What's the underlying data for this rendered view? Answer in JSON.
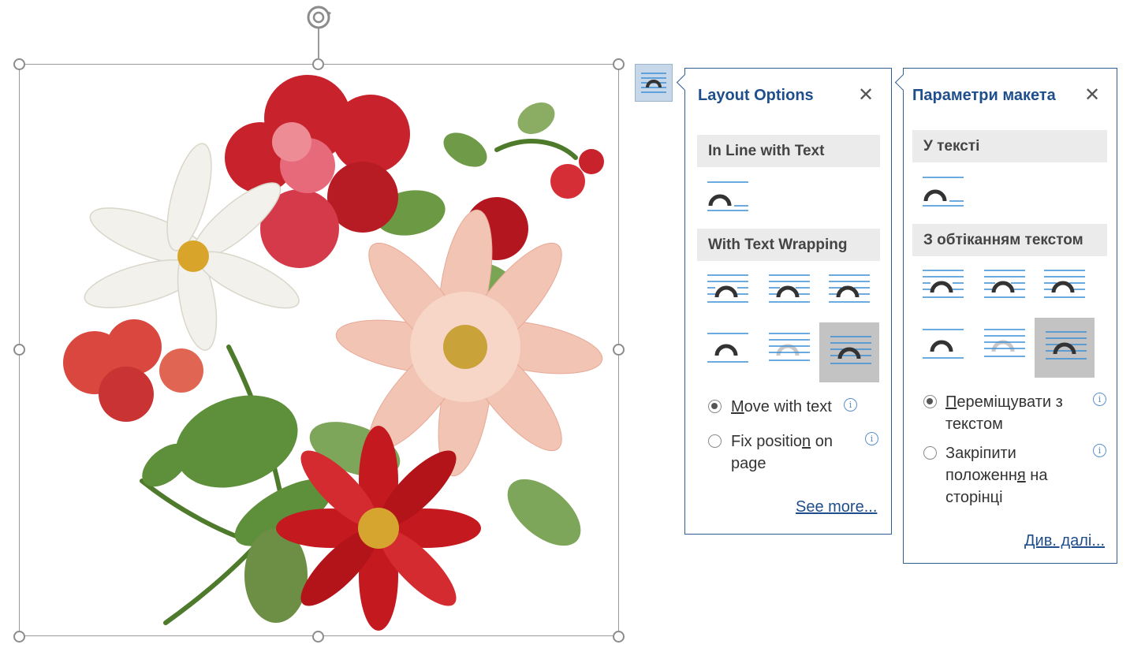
{
  "icons": {
    "rotate": "rotate-icon",
    "layout_button": "layout-options-icon",
    "close": "close-icon",
    "info": "info-icon"
  },
  "colors": {
    "panel_border": "#2e5f93",
    "title_blue": "#1f4e8c",
    "line_blue": "#3b8fd6",
    "section_bg": "#ebebeb",
    "selected_bg": "#c3c3c3",
    "layout_button_bg": "#c6d7ea"
  },
  "panel_en": {
    "title": "Layout Options",
    "close_glyph": "✕",
    "inline_header": "In Line with Text",
    "wrapping_header": "With Text Wrapping",
    "move_with_text": {
      "pre": "",
      "mnemonic": "M",
      "post": "ove with text"
    },
    "fix_position_line1": {
      "pre": "Fix positio",
      "mnemonic": "n",
      "post": " on"
    },
    "fix_position_line2": "page",
    "info_glyph": "i",
    "see_more": "See more..."
  },
  "panel_uk": {
    "title": "Параметри макета",
    "close_glyph": "✕",
    "inline_header": "У тексті",
    "wrapping_header": "З обтіканням текстом",
    "move_with_text_line1": {
      "pre": "",
      "mnemonic": "П",
      "post": "ереміщувати з"
    },
    "move_with_text_line2": "текстом",
    "fix_position_line1": "Закріпити",
    "fix_position_line2": {
      "pre": "положенн",
      "mnemonic": "я",
      "post": " на"
    },
    "fix_position_line3": "сторінці",
    "info_glyph": "i",
    "see_more": "Див. далі..."
  },
  "state": {
    "selected_wrap_option": "in-front-of-text",
    "position_mode": "move-with-text"
  }
}
